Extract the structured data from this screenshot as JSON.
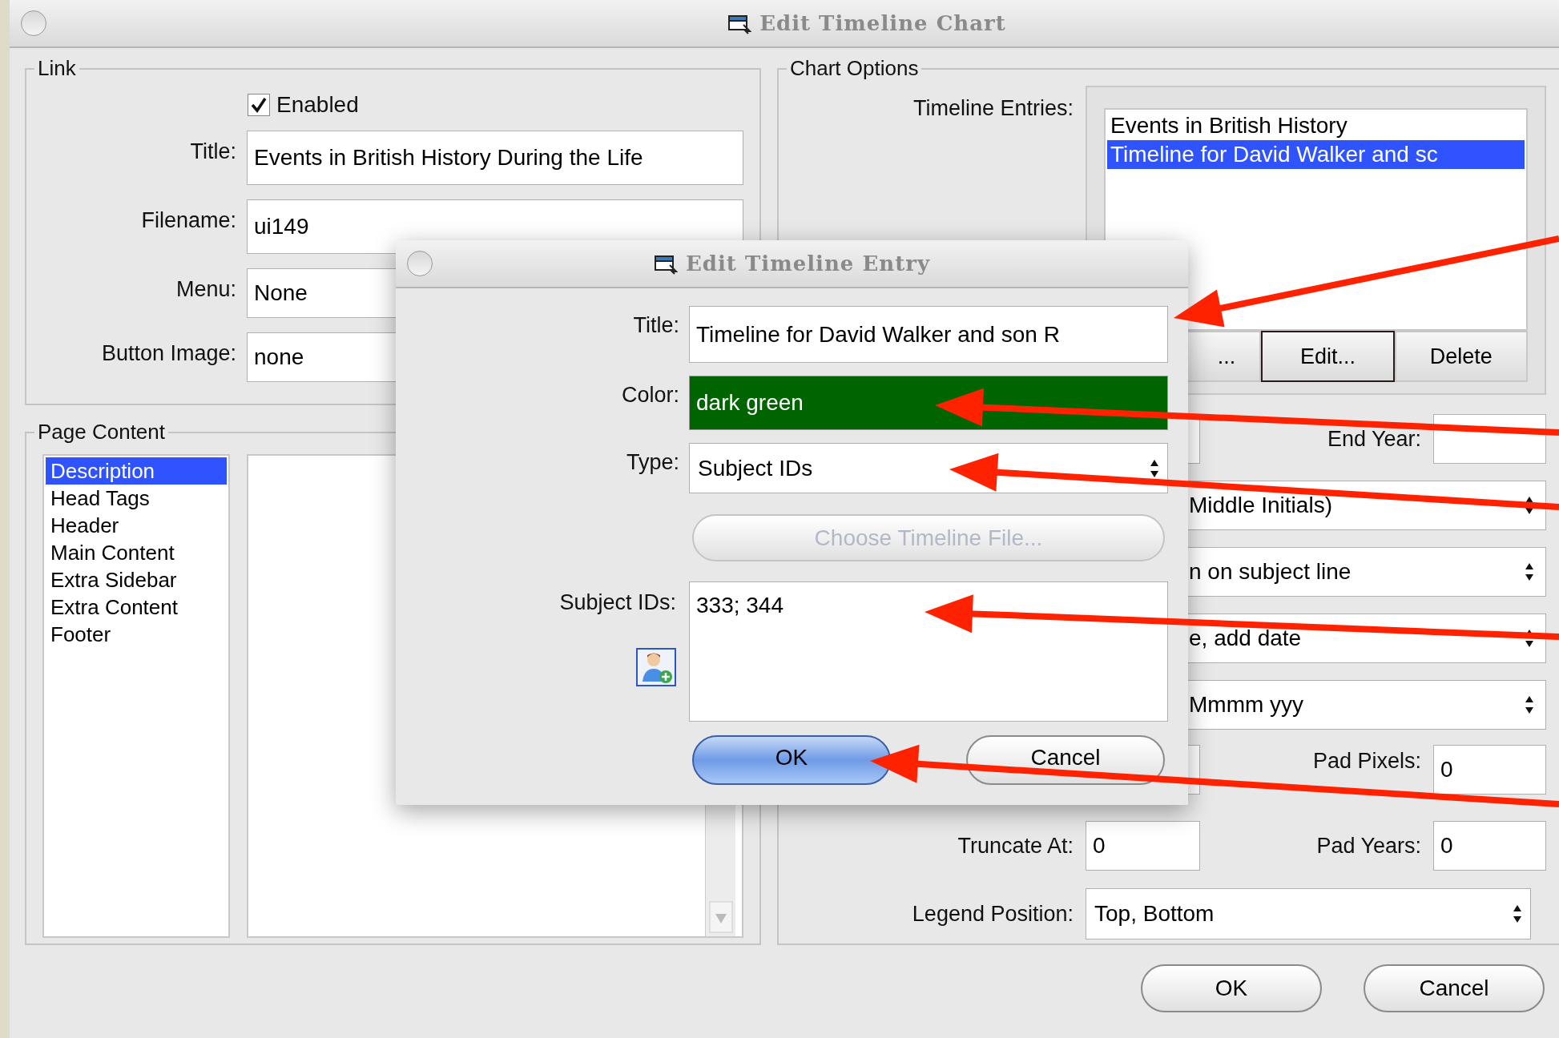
{
  "window": {
    "title": "Edit Timeline Chart"
  },
  "link": {
    "legend": "Link",
    "enabled": {
      "label": "Enabled",
      "checked": true
    },
    "fields": [
      {
        "label": "Title:",
        "value": "Events in British History During the Life"
      },
      {
        "label": "Filename:",
        "value": "ui149"
      },
      {
        "label": "Menu:",
        "value": "None"
      },
      {
        "label": "Button Image:",
        "value": "none"
      }
    ]
  },
  "page_content": {
    "legend": "Page Content",
    "sections": [
      {
        "label": "Description",
        "selected": true
      },
      {
        "label": "Head Tags",
        "selected": false
      },
      {
        "label": "Header",
        "selected": false
      },
      {
        "label": "Main Content",
        "selected": false
      },
      {
        "label": "Extra Sidebar",
        "selected": false
      },
      {
        "label": "Extra Content",
        "selected": false
      },
      {
        "label": "Footer",
        "selected": false
      }
    ]
  },
  "chart_options": {
    "legend": "Chart Options",
    "entries_label": "Timeline Entries:",
    "entries": [
      {
        "label": "Events in British History",
        "selected": false
      },
      {
        "label": "Timeline for David Walker and sc",
        "selected": true
      }
    ],
    "entry_buttons": [
      {
        "label": "...",
        "focused": false
      },
      {
        "label": "Edit...",
        "focused": true
      },
      {
        "label": "Delete",
        "focused": false
      }
    ],
    "end_year": {
      "label": "End Year:"
    },
    "dropdowns": [
      "Middle Initials)",
      "n on subject line",
      "e, add date",
      "Mmmm yyy"
    ],
    "pad_pixels": {
      "label": "Pad Pixels:",
      "value": "0"
    },
    "truncate_at": {
      "label": "Truncate At:",
      "value": "0"
    },
    "pad_years": {
      "label": "Pad Years:",
      "value": "0"
    },
    "legend_position": {
      "label": "Legend Position:",
      "value": "Top, Bottom"
    }
  },
  "buttons": [
    "OK",
    "Cancel"
  ],
  "dialog": {
    "title": "Edit Timeline Entry",
    "fields": [
      {
        "kind": "text",
        "label": "Title:",
        "value": "Timeline for David Walker and son R"
      },
      {
        "kind": "color",
        "label": "Color:",
        "value": "dark green",
        "color": "#006400"
      },
      {
        "kind": "select",
        "label": "Type:",
        "value": "Subject IDs"
      }
    ],
    "choose_button": {
      "label": "Choose Timeline File...",
      "disabled": true
    },
    "subject_ids": {
      "label": "Subject IDs:",
      "value": "333; 344"
    },
    "buttons": [
      {
        "label": "OK",
        "default": true
      },
      {
        "label": "Cancel",
        "default": false
      }
    ]
  }
}
